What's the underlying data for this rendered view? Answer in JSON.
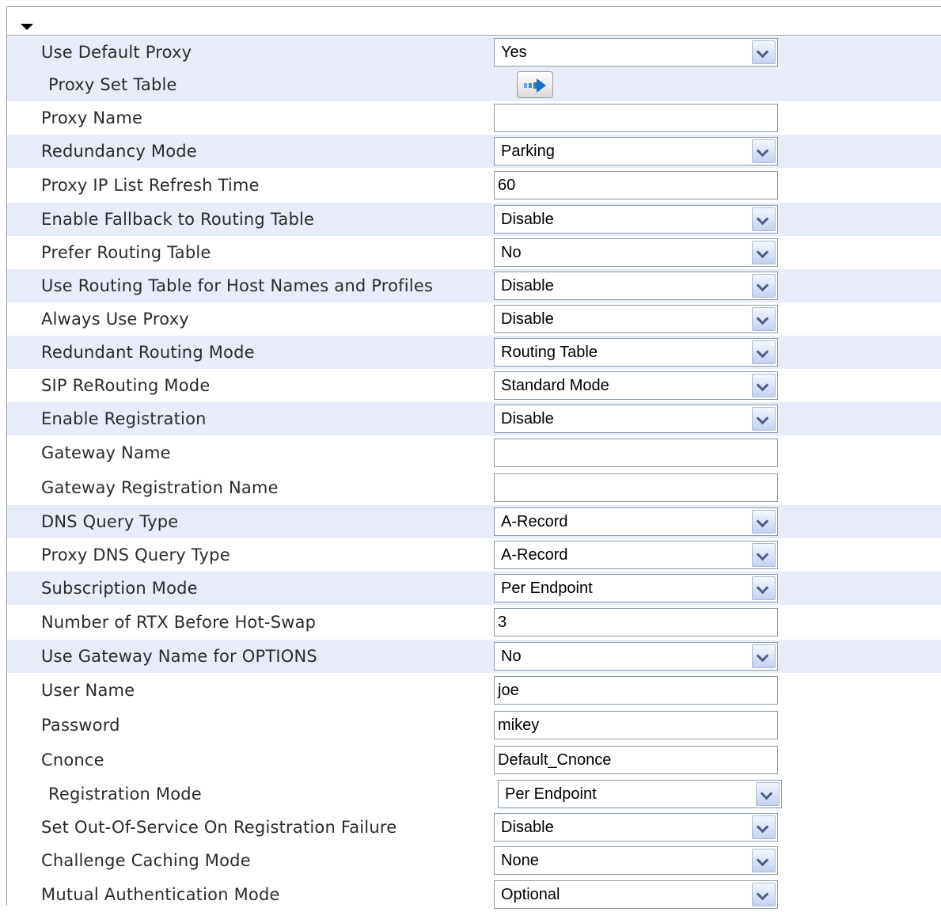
{
  "rows": [
    {
      "label": "Use Default Proxy",
      "type": "select",
      "value": "Yes"
    },
    {
      "label": "Proxy Set Table",
      "type": "button"
    },
    {
      "label": "Proxy Name",
      "type": "input",
      "value": ""
    },
    {
      "label": "Redundancy Mode",
      "type": "select",
      "value": "Parking"
    },
    {
      "label": "Proxy IP List Refresh Time",
      "type": "input",
      "value": "60"
    },
    {
      "label": "Enable Fallback to Routing Table",
      "type": "select",
      "value": "Disable"
    },
    {
      "label": "Prefer Routing Table",
      "type": "select",
      "value": "No"
    },
    {
      "label": "Use Routing Table for Host Names and Profiles",
      "type": "select",
      "value": "Disable"
    },
    {
      "label": "Always Use Proxy",
      "type": "select",
      "value": "Disable"
    },
    {
      "label": "Redundant Routing Mode",
      "type": "select",
      "value": "Routing Table"
    },
    {
      "label": "SIP ReRouting Mode",
      "type": "select",
      "value": "Standard Mode"
    },
    {
      "label": "Enable Registration",
      "type": "select",
      "value": "Disable"
    },
    {
      "label": "Gateway Name",
      "type": "input",
      "value": ""
    },
    {
      "label": "Gateway Registration Name",
      "type": "input",
      "value": ""
    },
    {
      "label": "DNS Query Type",
      "type": "select",
      "value": "A-Record"
    },
    {
      "label": "Proxy DNS Query Type",
      "type": "select",
      "value": "A-Record"
    },
    {
      "label": "Subscription Mode",
      "type": "select",
      "value": "Per Endpoint"
    },
    {
      "label": "Number of RTX Before Hot-Swap",
      "type": "input",
      "value": "3"
    },
    {
      "label": "Use Gateway Name for OPTIONS",
      "type": "select",
      "value": "No"
    },
    {
      "label": "User Name",
      "type": "input",
      "value": "joe"
    },
    {
      "label": "Password",
      "type": "input",
      "value": "mikey"
    },
    {
      "label": "Cnonce",
      "type": "input",
      "value": "Default_Cnonce"
    },
    {
      "label": "Registration Mode",
      "type": "select",
      "value": "Per Endpoint"
    },
    {
      "label": "Set Out-Of-Service On Registration Failure",
      "type": "select",
      "value": "Disable"
    },
    {
      "label": "Challenge Caching Mode",
      "type": "select",
      "value": "None"
    },
    {
      "label": "Mutual Authentication Mode",
      "type": "select",
      "value": "Optional"
    }
  ],
  "colors": {
    "row_shade": "#e8ecfa",
    "label_text": "#2b2b2b",
    "field_border": "#8a9aa8"
  },
  "icons": {
    "collapse": "triangle-down-icon",
    "proxy_set_table": "arrow-right-icon"
  }
}
